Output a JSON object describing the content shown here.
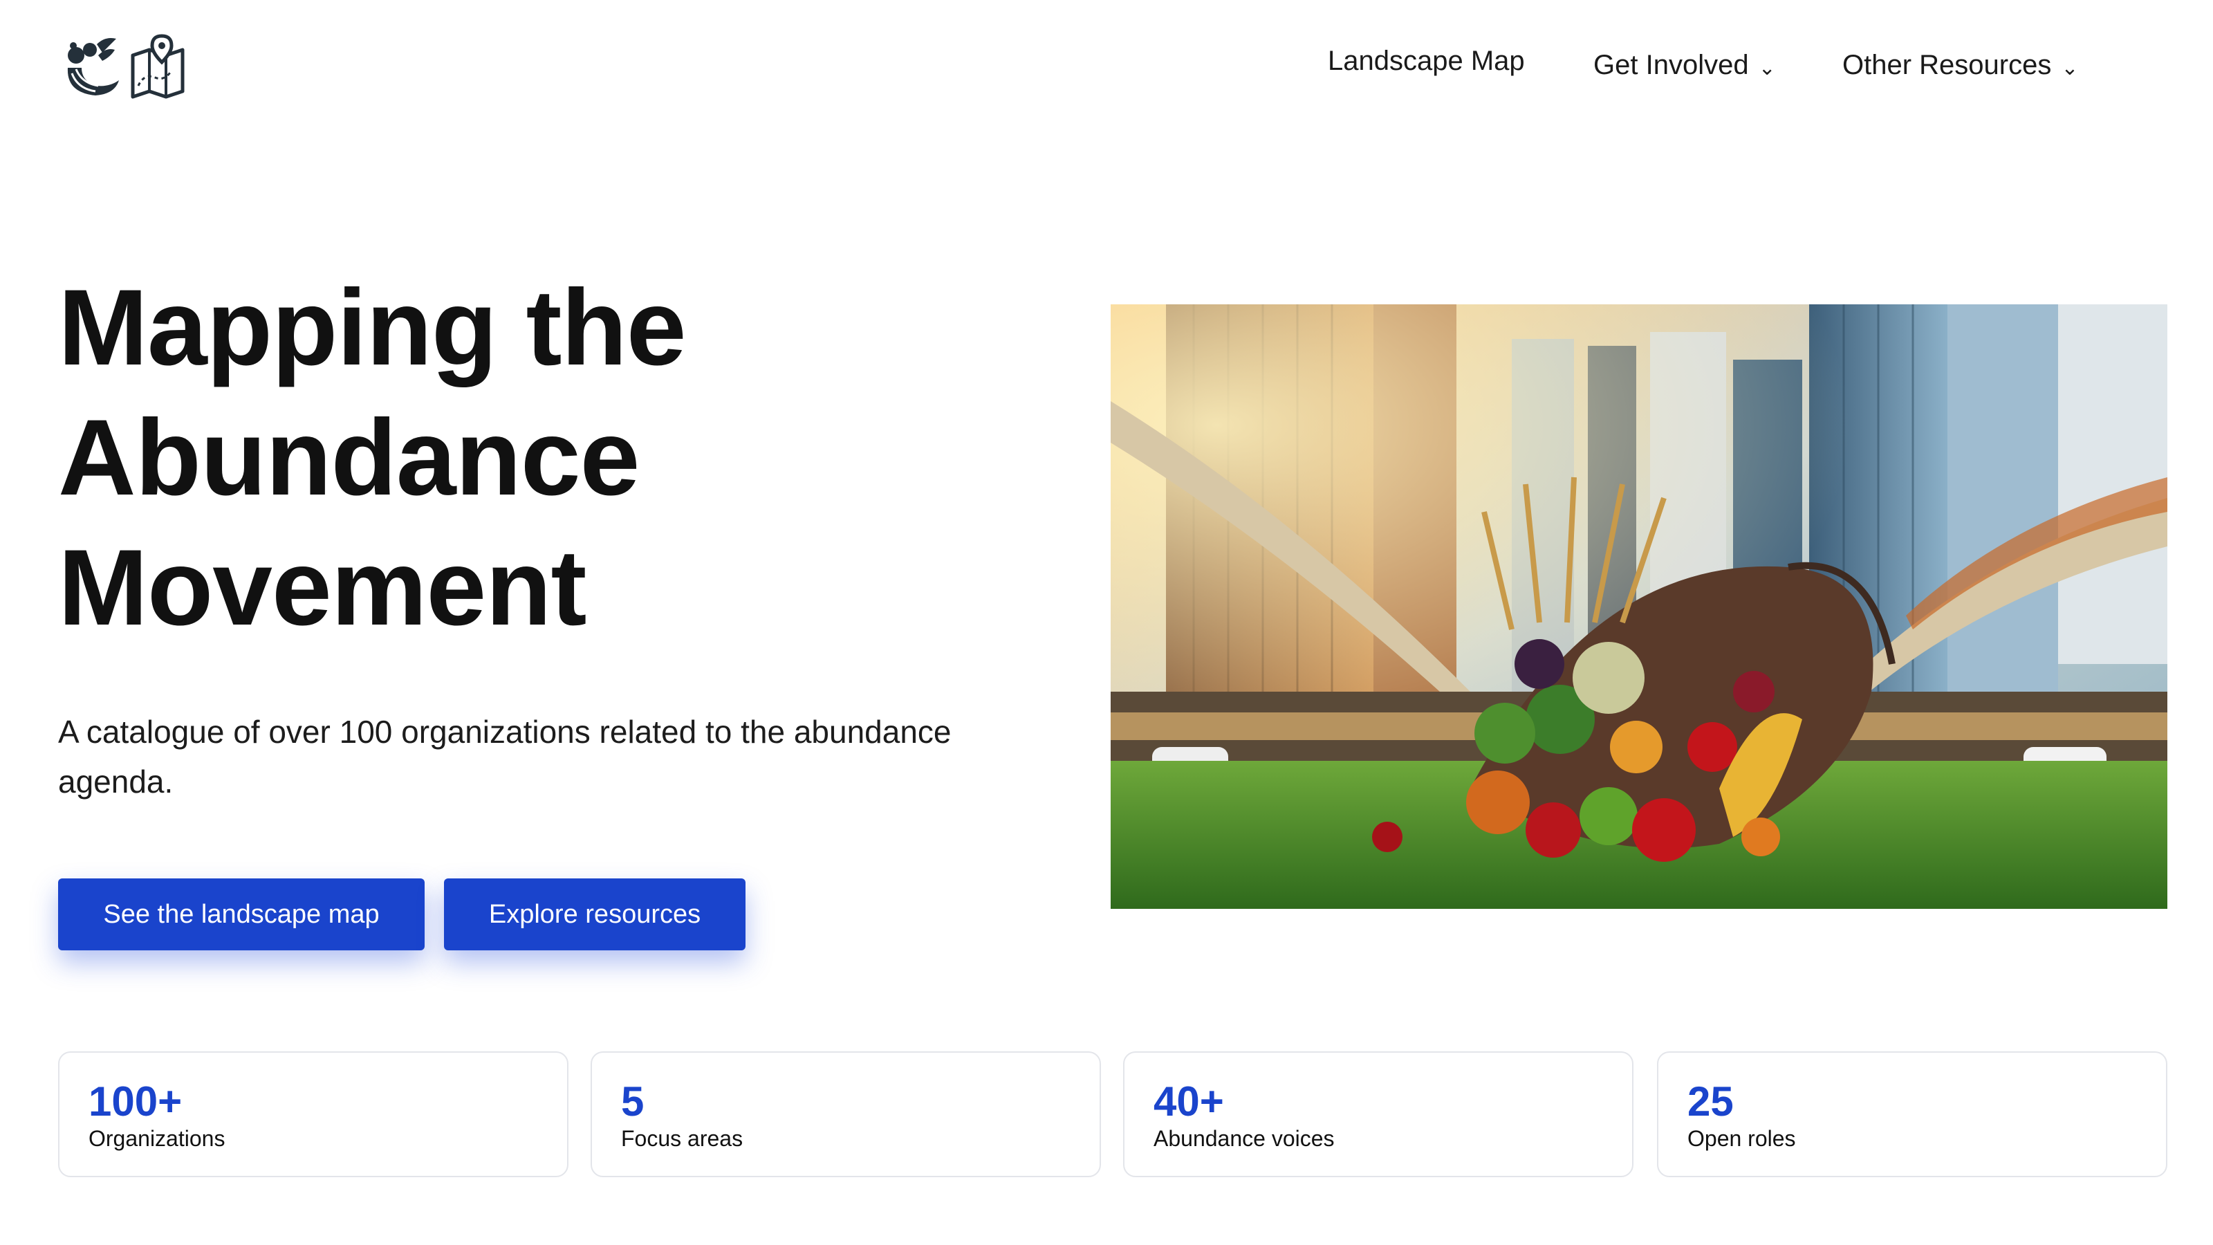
{
  "header": {
    "nav": [
      {
        "label": "Landscape Map",
        "has_dropdown": false
      },
      {
        "label": "Get Involved",
        "has_dropdown": true
      },
      {
        "label": "Other Resources",
        "has_dropdown": true
      }
    ],
    "dropdown_glyph": "⌄",
    "logo_icons": [
      "cornucopia-icon",
      "folded-map-pin-icon"
    ]
  },
  "hero": {
    "title_lines": [
      "Mapping the",
      "Abundance",
      "Movement"
    ],
    "subtitle": "A catalogue of over 100 organizations related to the abundance agenda.",
    "buttons": {
      "primary": "See the landscape map",
      "secondary": "Explore resources"
    }
  },
  "stats": [
    {
      "value": "100+",
      "label": "Organizations"
    },
    {
      "value": "5",
      "label": "Focus areas"
    },
    {
      "value": "40+",
      "label": "Abundance voices"
    },
    {
      "value": "25",
      "label": "Open roles"
    }
  ],
  "colors": {
    "accent": "#1a44cc",
    "text": "#111111",
    "card_border": "#e3e5ea"
  }
}
